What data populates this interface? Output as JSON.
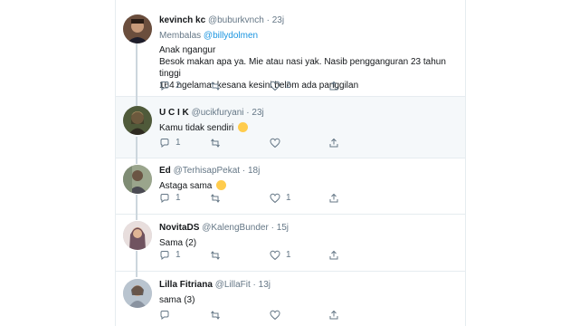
{
  "tweets": [
    {
      "name": "kevinch kc",
      "handle": "@buburkvnch",
      "dot": "·",
      "time": "23j",
      "replying_prefix": "Membalas",
      "replying_to": "@billydolmen",
      "text_lines": [
        "Anak ngangur",
        "Besok makan apa ya. Mie atau nasi yak. Nasib pengganguran 23 tahun tinggi",
        "164 ngelamar kesana kesini belom ada panggilan"
      ],
      "replies": "2",
      "retweets": "",
      "likes": "2"
    },
    {
      "name": "U C I K",
      "handle": "@ucikfuryani",
      "dot": "·",
      "time": "23j",
      "text": "Kamu tidak sendiri",
      "emoji": "relieved-face",
      "replies": "1",
      "retweets": "",
      "likes": ""
    },
    {
      "name": "Ed",
      "handle": "@TerhisapPekat",
      "dot": "·",
      "time": "18j",
      "text": "Astaga sama",
      "emoji": "hugging-face",
      "replies": "1",
      "retweets": "",
      "likes": "1"
    },
    {
      "name": "NovitaDS",
      "handle": "@KalengBunder",
      "dot": "·",
      "time": "15j",
      "text": "Sama (2)",
      "replies": "1",
      "retweets": "",
      "likes": "1"
    },
    {
      "name": "Lilla Fitriana",
      "handle": "@LillaFit",
      "dot": "·",
      "time": "13j",
      "text": "sama (3)",
      "replies": "",
      "retweets": "",
      "likes": ""
    }
  ],
  "colors": {
    "link": "#1b95e0",
    "muted": "#657786",
    "text": "#14171a",
    "border": "#e6ecf0",
    "thread": "#ccd6dd",
    "highlight": "#f5f8fa"
  }
}
